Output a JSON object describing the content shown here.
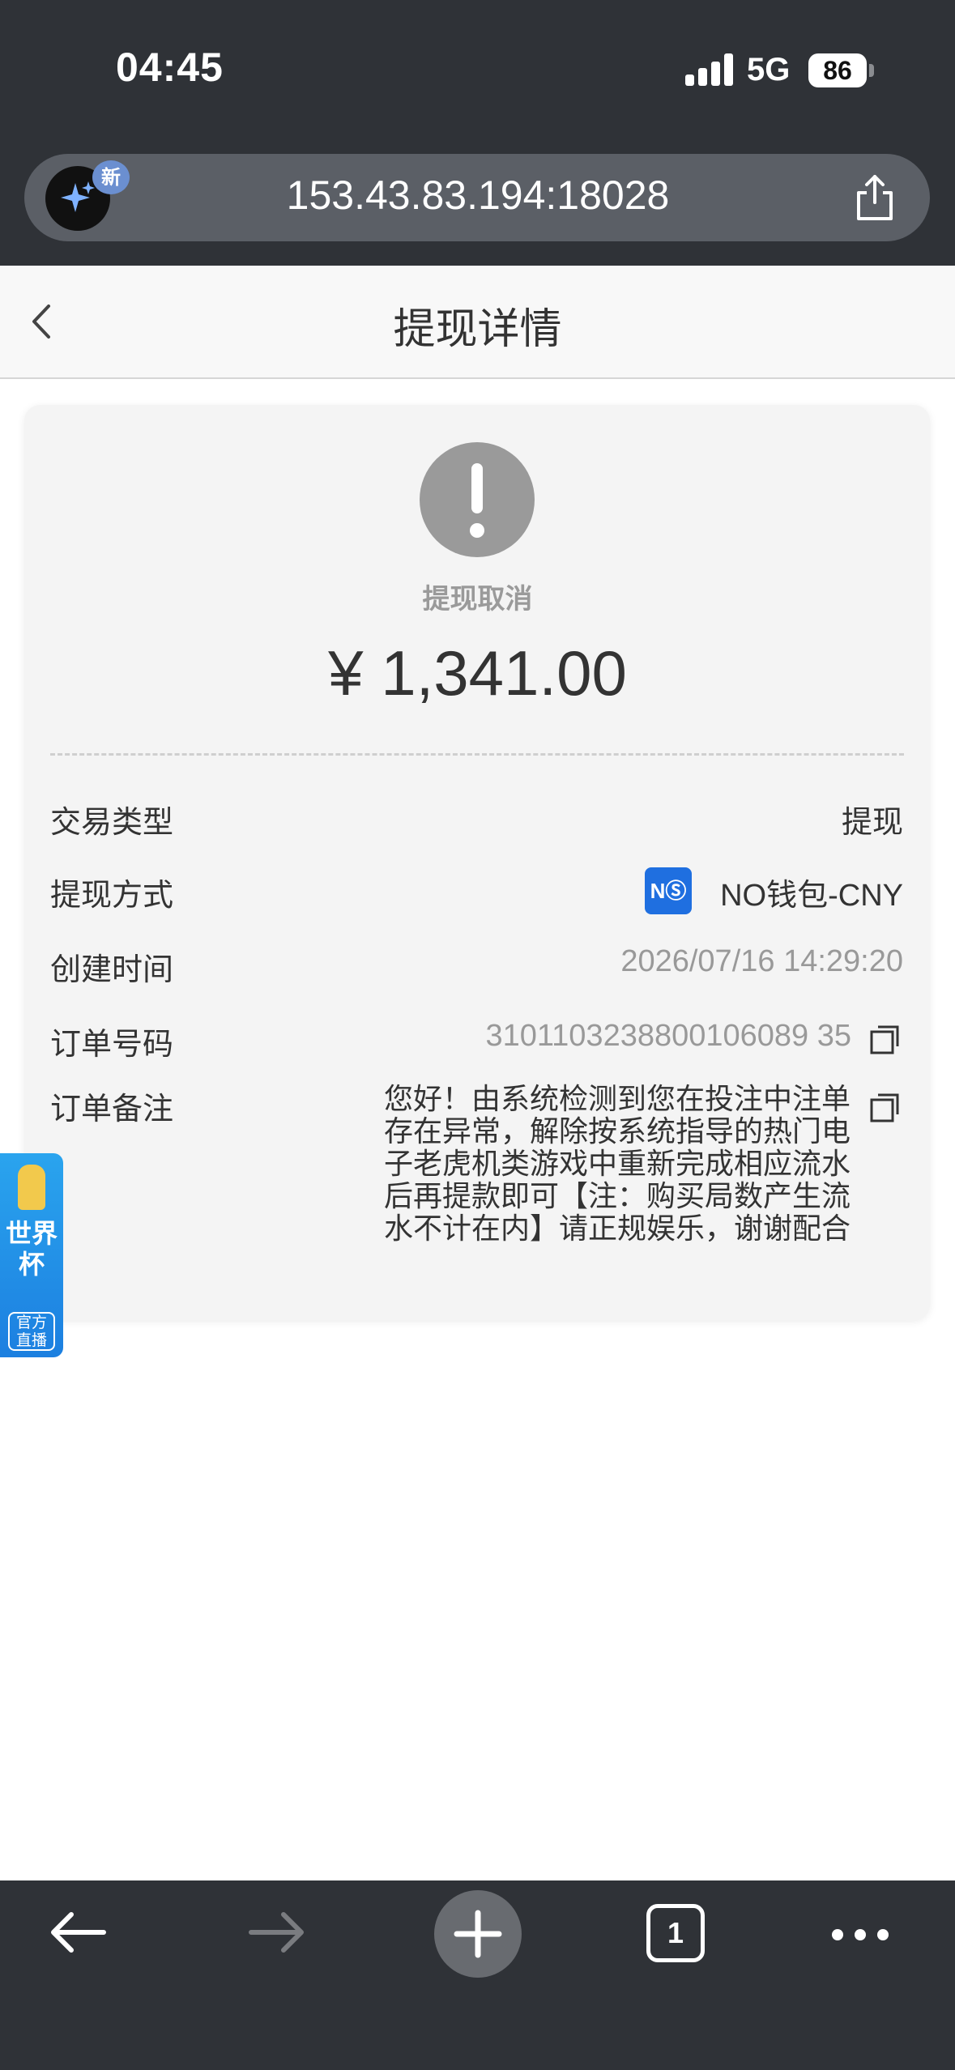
{
  "status_bar": {
    "time": "04:45",
    "network": "5G",
    "battery": "86"
  },
  "browser": {
    "url": "153.43.83.194:18028",
    "badge": "新",
    "tab_count": "1"
  },
  "header": {
    "title": "提现详情"
  },
  "withdrawal": {
    "status": "提现取消",
    "amount": "¥ 1,341.00",
    "rows": {
      "type_label": "交易类型",
      "type_value": "提现",
      "method_label": "提现方式",
      "method_logo": "NⓈ",
      "method_value": "NO钱包-CNY",
      "created_label": "创建时间",
      "created_value": "2026/07/16 14:29:20",
      "order_label": "订单号码",
      "order_value": "3101103238800106089 35",
      "note_label": "订单备注",
      "note_value": "您好！由系统检测到您在投注中注单存在异常，解除按系统指导的热门电子老虎机类游戏中重新完成相应流水后再提款即可【注：购买局数产生流水不计在内】请正规娱乐，谢谢配合"
    }
  },
  "floating_badge": {
    "title": "世界杯",
    "subtitle": "官方直播"
  },
  "colors": {
    "chrome": "#2f3237",
    "status_gray": "#9a9a9a",
    "accent_blue": "#1f6fe0"
  }
}
